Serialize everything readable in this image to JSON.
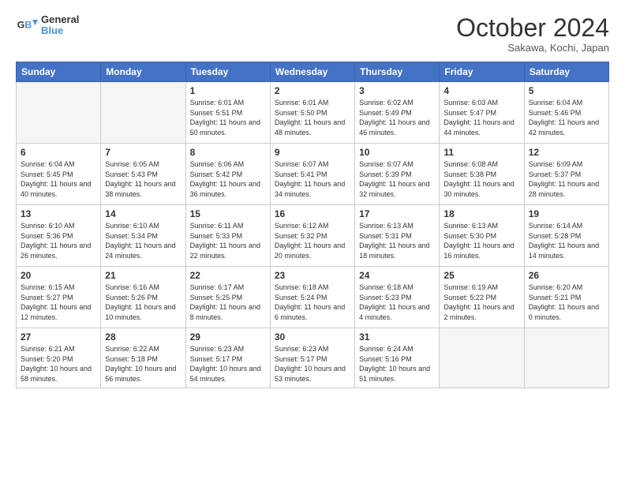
{
  "logo": {
    "line1": "General",
    "line2": "Blue"
  },
  "title": "October 2024",
  "subtitle": "Sakawa, Kochi, Japan",
  "days_of_week": [
    "Sunday",
    "Monday",
    "Tuesday",
    "Wednesday",
    "Thursday",
    "Friday",
    "Saturday"
  ],
  "weeks": [
    [
      {
        "day": "",
        "info": ""
      },
      {
        "day": "",
        "info": ""
      },
      {
        "day": "1",
        "info": "Sunrise: 6:01 AM\nSunset: 5:51 PM\nDaylight: 11 hours and 50 minutes."
      },
      {
        "day": "2",
        "info": "Sunrise: 6:01 AM\nSunset: 5:50 PM\nDaylight: 11 hours and 48 minutes."
      },
      {
        "day": "3",
        "info": "Sunrise: 6:02 AM\nSunset: 5:49 PM\nDaylight: 11 hours and 46 minutes."
      },
      {
        "day": "4",
        "info": "Sunrise: 6:03 AM\nSunset: 5:47 PM\nDaylight: 11 hours and 44 minutes."
      },
      {
        "day": "5",
        "info": "Sunrise: 6:04 AM\nSunset: 5:46 PM\nDaylight: 11 hours and 42 minutes."
      }
    ],
    [
      {
        "day": "6",
        "info": "Sunrise: 6:04 AM\nSunset: 5:45 PM\nDaylight: 11 hours and 40 minutes."
      },
      {
        "day": "7",
        "info": "Sunrise: 6:05 AM\nSunset: 5:43 PM\nDaylight: 11 hours and 38 minutes."
      },
      {
        "day": "8",
        "info": "Sunrise: 6:06 AM\nSunset: 5:42 PM\nDaylight: 11 hours and 36 minutes."
      },
      {
        "day": "9",
        "info": "Sunrise: 6:07 AM\nSunset: 5:41 PM\nDaylight: 11 hours and 34 minutes."
      },
      {
        "day": "10",
        "info": "Sunrise: 6:07 AM\nSunset: 5:39 PM\nDaylight: 11 hours and 32 minutes."
      },
      {
        "day": "11",
        "info": "Sunrise: 6:08 AM\nSunset: 5:38 PM\nDaylight: 11 hours and 30 minutes."
      },
      {
        "day": "12",
        "info": "Sunrise: 6:09 AM\nSunset: 5:37 PM\nDaylight: 11 hours and 28 minutes."
      }
    ],
    [
      {
        "day": "13",
        "info": "Sunrise: 6:10 AM\nSunset: 5:36 PM\nDaylight: 11 hours and 26 minutes."
      },
      {
        "day": "14",
        "info": "Sunrise: 6:10 AM\nSunset: 5:34 PM\nDaylight: 11 hours and 24 minutes."
      },
      {
        "day": "15",
        "info": "Sunrise: 6:11 AM\nSunset: 5:33 PM\nDaylight: 11 hours and 22 minutes."
      },
      {
        "day": "16",
        "info": "Sunrise: 6:12 AM\nSunset: 5:32 PM\nDaylight: 11 hours and 20 minutes."
      },
      {
        "day": "17",
        "info": "Sunrise: 6:13 AM\nSunset: 5:31 PM\nDaylight: 11 hours and 18 minutes."
      },
      {
        "day": "18",
        "info": "Sunrise: 6:13 AM\nSunset: 5:30 PM\nDaylight: 11 hours and 16 minutes."
      },
      {
        "day": "19",
        "info": "Sunrise: 6:14 AM\nSunset: 5:28 PM\nDaylight: 11 hours and 14 minutes."
      }
    ],
    [
      {
        "day": "20",
        "info": "Sunrise: 6:15 AM\nSunset: 5:27 PM\nDaylight: 11 hours and 12 minutes."
      },
      {
        "day": "21",
        "info": "Sunrise: 6:16 AM\nSunset: 5:26 PM\nDaylight: 11 hours and 10 minutes."
      },
      {
        "day": "22",
        "info": "Sunrise: 6:17 AM\nSunset: 5:25 PM\nDaylight: 11 hours and 8 minutes."
      },
      {
        "day": "23",
        "info": "Sunrise: 6:18 AM\nSunset: 5:24 PM\nDaylight: 11 hours and 6 minutes."
      },
      {
        "day": "24",
        "info": "Sunrise: 6:18 AM\nSunset: 5:23 PM\nDaylight: 11 hours and 4 minutes."
      },
      {
        "day": "25",
        "info": "Sunrise: 6:19 AM\nSunset: 5:22 PM\nDaylight: 11 hours and 2 minutes."
      },
      {
        "day": "26",
        "info": "Sunrise: 6:20 AM\nSunset: 5:21 PM\nDaylight: 11 hours and 0 minutes."
      }
    ],
    [
      {
        "day": "27",
        "info": "Sunrise: 6:21 AM\nSunset: 5:20 PM\nDaylight: 10 hours and 58 minutes."
      },
      {
        "day": "28",
        "info": "Sunrise: 6:22 AM\nSunset: 5:18 PM\nDaylight: 10 hours and 56 minutes."
      },
      {
        "day": "29",
        "info": "Sunrise: 6:23 AM\nSunset: 5:17 PM\nDaylight: 10 hours and 54 minutes."
      },
      {
        "day": "30",
        "info": "Sunrise: 6:23 AM\nSunset: 5:17 PM\nDaylight: 10 hours and 53 minutes."
      },
      {
        "day": "31",
        "info": "Sunrise: 6:24 AM\nSunset: 5:16 PM\nDaylight: 10 hours and 51 minutes."
      },
      {
        "day": "",
        "info": ""
      },
      {
        "day": "",
        "info": ""
      }
    ]
  ]
}
